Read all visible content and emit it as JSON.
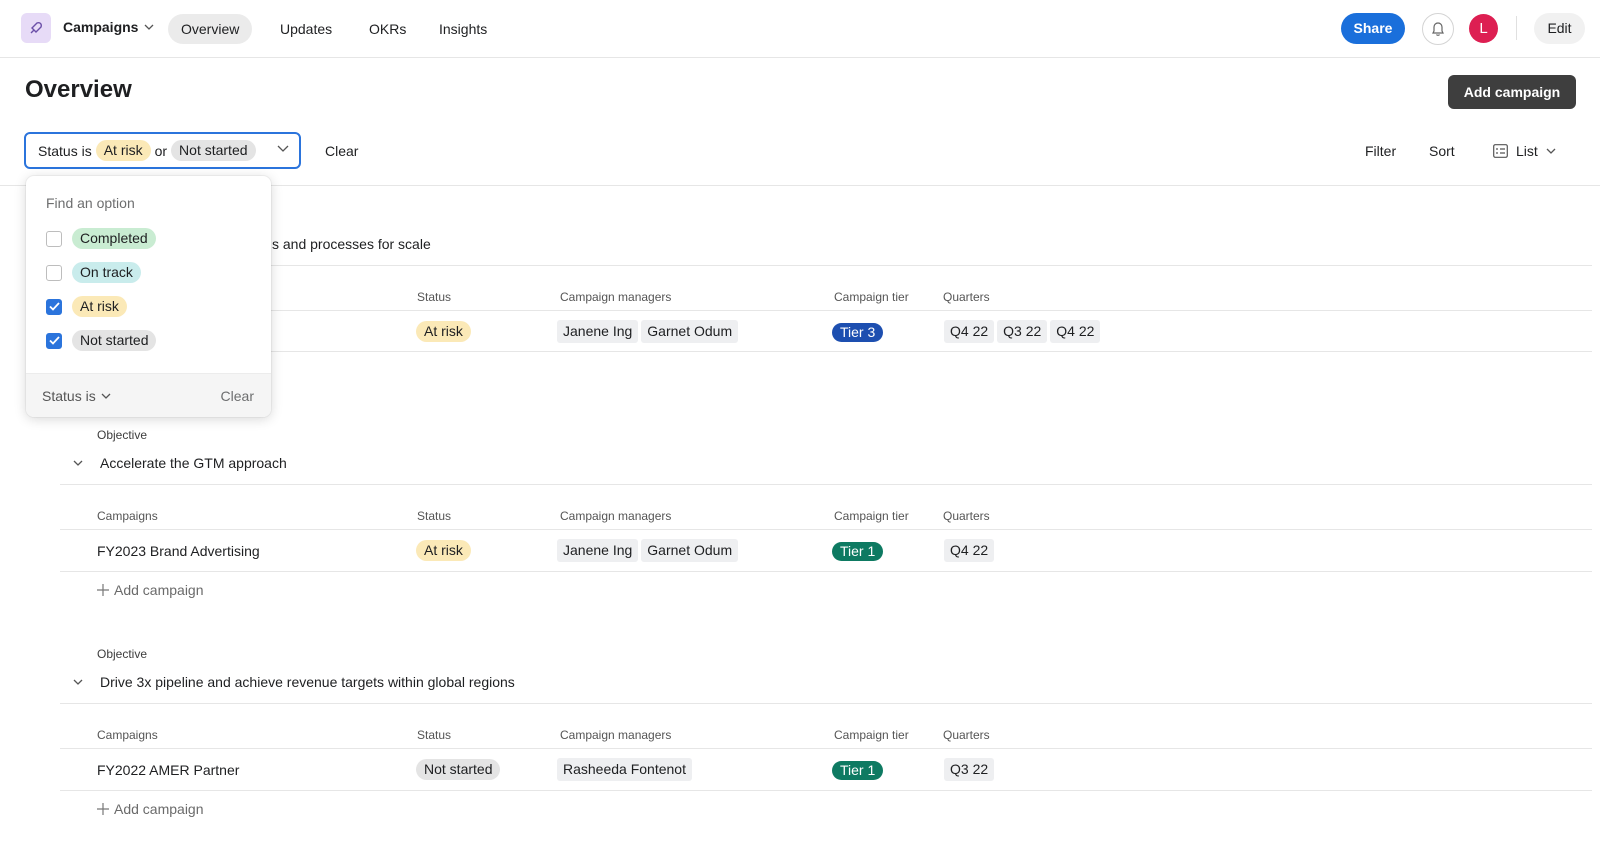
{
  "topbar": {
    "app_name": "Campaigns",
    "tabs": [
      {
        "label": "Overview",
        "active": true
      },
      {
        "label": "Updates",
        "active": false
      },
      {
        "label": "OKRs",
        "active": false
      },
      {
        "label": "Insights",
        "active": false
      }
    ],
    "share_label": "Share",
    "avatar_initial": "L",
    "edit_label": "Edit"
  },
  "page": {
    "title": "Overview",
    "add_campaign_label": "Add campaign"
  },
  "filter": {
    "prefix": "Status is",
    "value1": "At risk",
    "joiner": "or",
    "value2": "Not started",
    "clear_label": "Clear",
    "filter_label": "Filter",
    "sort_label": "Sort",
    "view_label": "List"
  },
  "dropdown": {
    "search_placeholder": "Find an option",
    "options": [
      {
        "label": "Completed",
        "checked": false
      },
      {
        "label": "On track",
        "checked": false
      },
      {
        "label": "At risk",
        "checked": true
      },
      {
        "label": "Not started",
        "checked": true
      }
    ],
    "footer_left": "Status is",
    "footer_right": "Clear"
  },
  "columns": {
    "campaigns": "Campaigns",
    "status": "Status",
    "managers": "Campaign managers",
    "tier": "Campaign tier",
    "quarters": "Quarters"
  },
  "objectives": [
    {
      "title_visible": "s and processes for scale",
      "rows": [
        {
          "status": "At risk",
          "managers": [
            "Janene Ing",
            "Garnet Odum"
          ],
          "tier": "Tier 3",
          "quarters": [
            "Q4 22",
            "Q3 22",
            "Q4 22"
          ]
        }
      ]
    },
    {
      "label": "Objective",
      "title": "Accelerate the GTM approach",
      "rows": [
        {
          "campaign": "FY2023 Brand Advertising",
          "status": "At risk",
          "managers": [
            "Janene Ing",
            "Garnet Odum"
          ],
          "tier": "Tier 1",
          "quarters": [
            "Q4 22"
          ]
        }
      ],
      "add_label": "Add campaign"
    },
    {
      "label": "Objective",
      "title": "Drive 3x pipeline and achieve revenue targets within global regions",
      "rows": [
        {
          "campaign": "FY2022 AMER Partner",
          "status": "Not started",
          "managers": [
            "Rasheeda Fontenot"
          ],
          "tier": "Tier 1",
          "quarters": [
            "Q3 22"
          ]
        }
      ],
      "add_label": "Add campaign"
    }
  ],
  "colors": {
    "accent": "#1a6fdb",
    "at_risk_bg": "#fbe9b7",
    "not_started_bg": "#e4e4e4",
    "tier3": "#1d4fb0",
    "tier1": "#0e7a62"
  }
}
